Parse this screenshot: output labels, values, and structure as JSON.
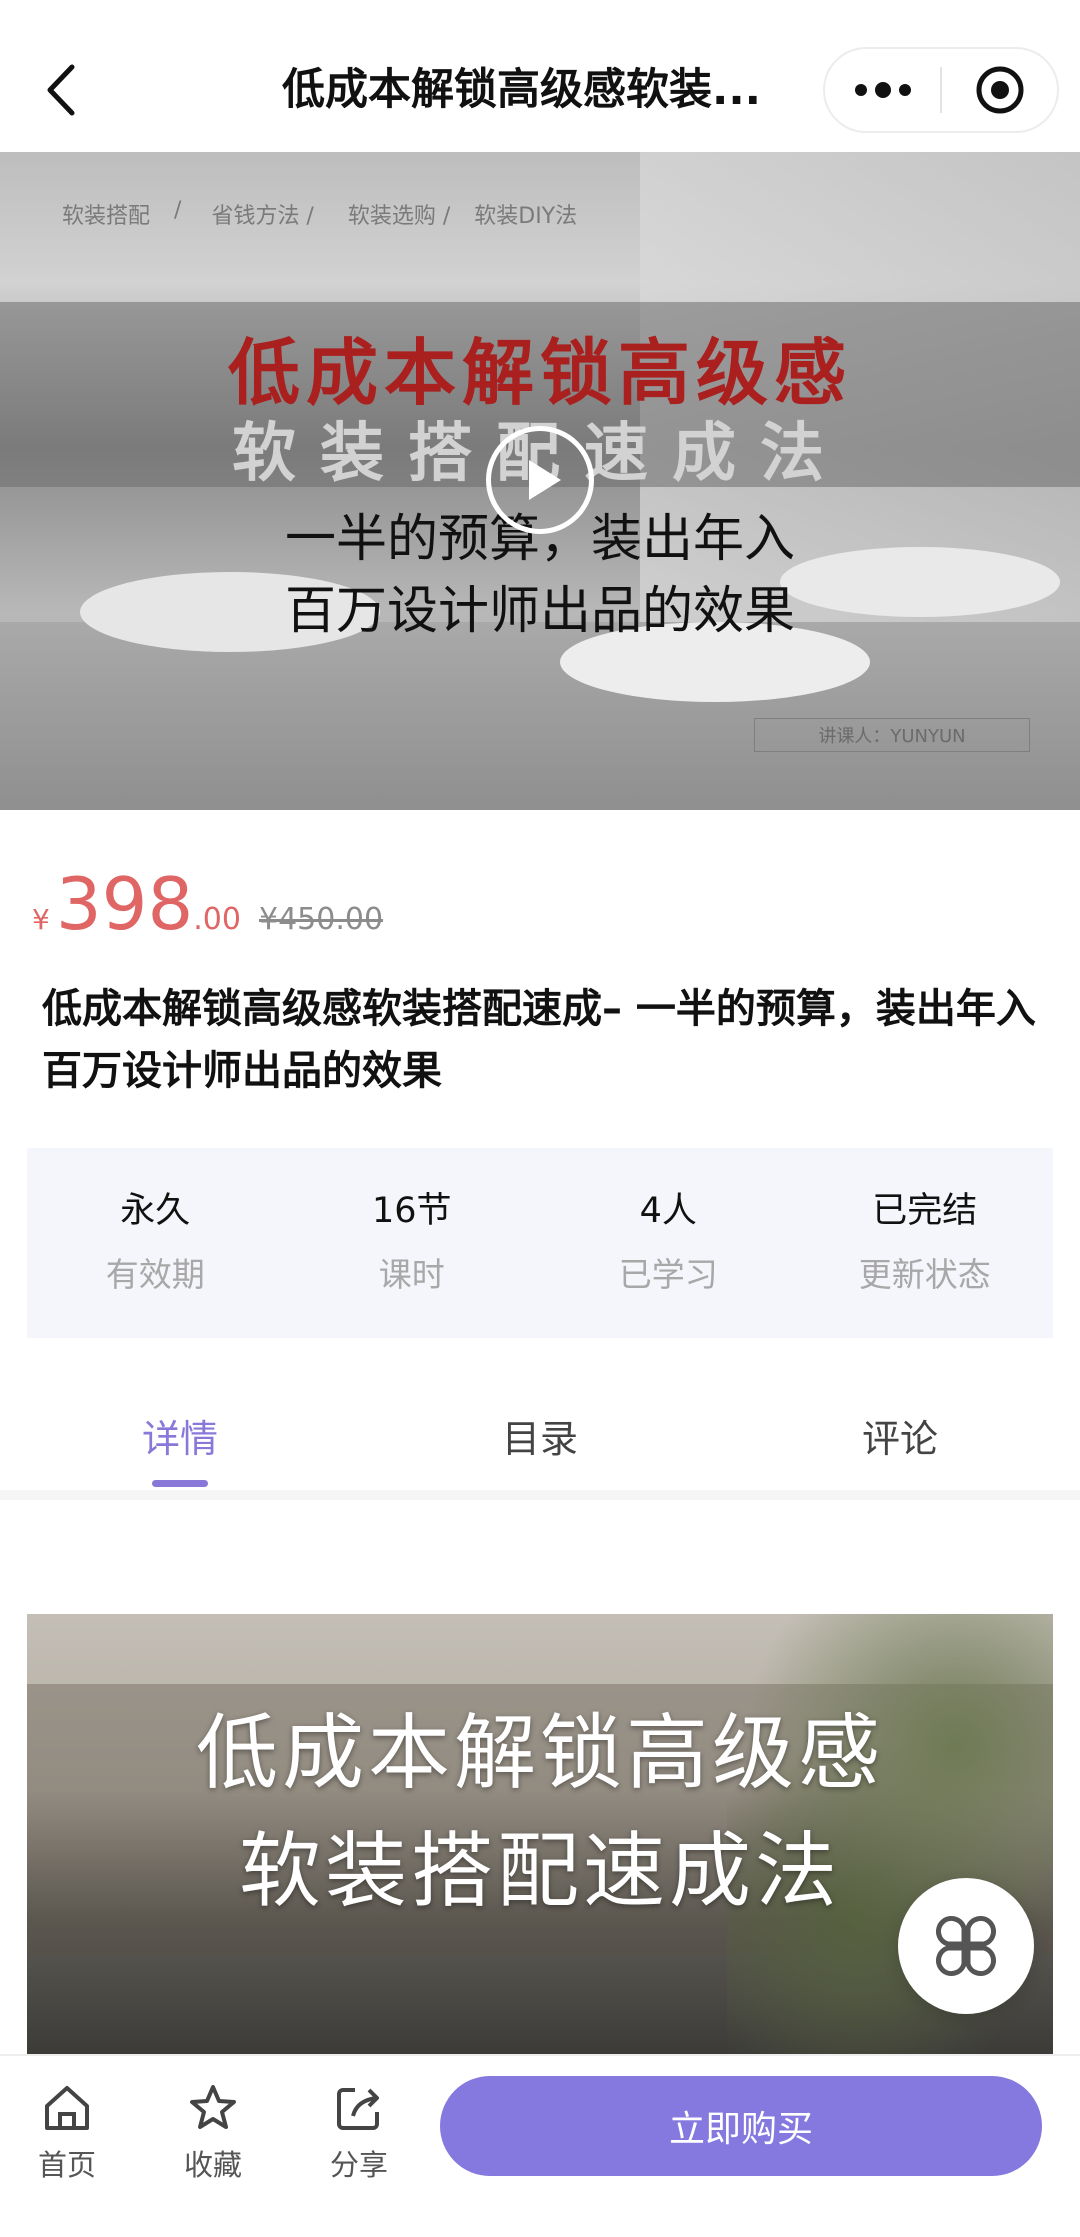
{
  "header": {
    "title": "低成本解锁高级感软装...",
    "back_icon": "chevron-left-icon",
    "more_icon": "more-dots-icon",
    "target_icon": "target-icon"
  },
  "hero": {
    "breadcrumb": [
      "软装搭配",
      "/",
      "省钱方法 /",
      "软装选购 /",
      "软装DIY法"
    ],
    "headline_red": "低成本解锁高级感",
    "headline_grey": "软装搭配速成法",
    "sub_line1": "一半的预算，装出年入",
    "sub_line2": "百万设计师出品的效果",
    "lecturer": "讲课人：YUNYUN",
    "play_icon": "play-icon"
  },
  "price": {
    "currency": "¥",
    "integer": "398",
    "decimal": ".00",
    "original": "¥450.00",
    "accent": "#e06666"
  },
  "course_title": "低成本解锁高级感软装搭配速成– 一半的预算，装出年入百万设计师出品的效果",
  "stats": [
    {
      "value": "永久",
      "label": "有效期"
    },
    {
      "value": "16节",
      "label": "课时"
    },
    {
      "value": "4人",
      "label": "已学习"
    },
    {
      "value": "已完结",
      "label": "更新状态"
    }
  ],
  "tabs": [
    {
      "label": "详情",
      "active": true
    },
    {
      "label": "目录",
      "active": false
    },
    {
      "label": "评论",
      "active": false
    }
  ],
  "detail": {
    "line1": "低成本解锁高级感",
    "line2": "软装搭配速成法"
  },
  "float_icon": "grid-menu-icon",
  "bottom": {
    "home": {
      "label": "首页",
      "icon": "home-icon"
    },
    "favorite": {
      "label": "收藏",
      "icon": "star-icon"
    },
    "share": {
      "label": "分享",
      "icon": "share-icon"
    },
    "buy_label": "立即购买"
  },
  "colors": {
    "brand": "#8579e0",
    "tab_active": "#8a78d8",
    "price": "#e06666"
  }
}
